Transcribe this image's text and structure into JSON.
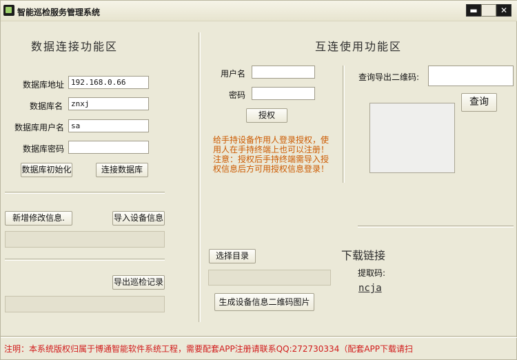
{
  "window": {
    "title": "智能巡检服务管理系统",
    "min_glyph": "▬",
    "max_glyph": "",
    "close_glyph": "✕"
  },
  "left": {
    "title": "数据连接功能区",
    "db_address_label": "数据库地址",
    "db_address_value": "192.168.0.66",
    "db_name_label": "数据库名",
    "db_name_value": "znxj",
    "db_user_label": "数据库用户名",
    "db_user_value": "sa",
    "db_password_label": "数据库密码",
    "db_password_value": "",
    "init_button": "数据库初始化",
    "connect_button": "连接数据库",
    "add_edit_button": "新增修改信息.",
    "import_button": "导入设备信息",
    "export_button": "导出巡检记录"
  },
  "right": {
    "title": "互连使用功能区",
    "username_label": "用户名",
    "username_value": "",
    "password_label": "密码",
    "password_value": "",
    "auth_button": "授权",
    "auth_note": "给手持设备作用人登录授权，使用人在手持终端上也可以注册！注意：授权后手持终端需导入授权信息后方可用授权信息登录！",
    "qr_query_label": "查询导出二维码:",
    "qr_query_value": "",
    "query_button": "查询",
    "select_dir_button": "选择目录",
    "gen_qr_button": "生成设备信息二维码图片",
    "download_title": "下载链接",
    "code_label": "提取码:",
    "code_value": "ncja"
  },
  "footer": {
    "text": "注明：本系统版权归属于博通智能软件系统工程，需要配套APP注册请联系QQ:272730334（配套APP下载请扫"
  },
  "colors": {
    "accent_orange": "#cc5a00",
    "footer_red": "#d11a1a",
    "window_bg": "#ebe9d8"
  }
}
